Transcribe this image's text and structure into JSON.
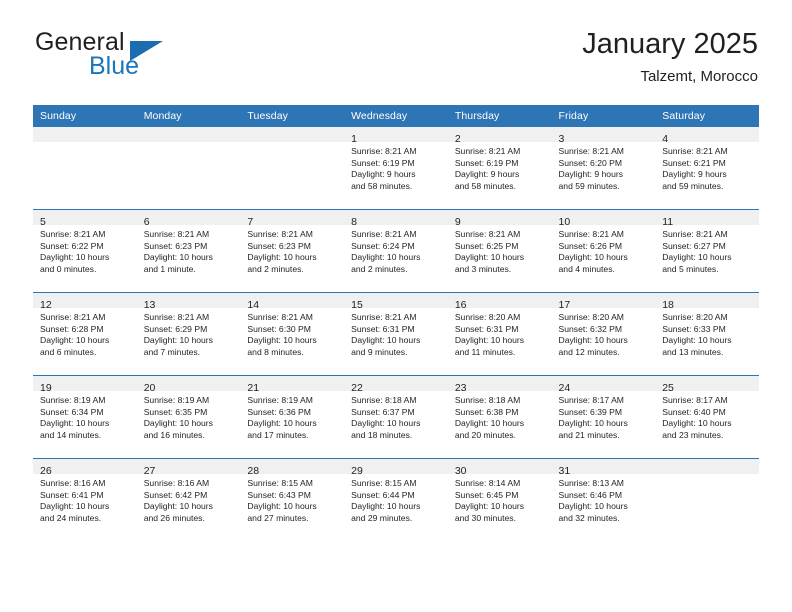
{
  "brand": {
    "name_part1": "General",
    "name_part2": "Blue",
    "logo_icon": "triangle-logo-icon"
  },
  "header": {
    "title": "January 2025",
    "subtitle": "Talzemt, Morocco"
  },
  "colors": {
    "header_blue": "#2e75b6",
    "brand_blue": "#1b75bb",
    "daynum_bg": "#f0f0f0",
    "text": "#231f20"
  },
  "weekday_headers": [
    "Sunday",
    "Monday",
    "Tuesday",
    "Wednesday",
    "Thursday",
    "Friday",
    "Saturday"
  ],
  "weeks": [
    [
      {
        "day": "",
        "sunrise": "",
        "sunset": "",
        "daylight1": "",
        "daylight2": ""
      },
      {
        "day": "",
        "sunrise": "",
        "sunset": "",
        "daylight1": "",
        "daylight2": ""
      },
      {
        "day": "",
        "sunrise": "",
        "sunset": "",
        "daylight1": "",
        "daylight2": ""
      },
      {
        "day": "1",
        "sunrise": "Sunrise: 8:21 AM",
        "sunset": "Sunset: 6:19 PM",
        "daylight1": "Daylight: 9 hours",
        "daylight2": "and 58 minutes."
      },
      {
        "day": "2",
        "sunrise": "Sunrise: 8:21 AM",
        "sunset": "Sunset: 6:19 PM",
        "daylight1": "Daylight: 9 hours",
        "daylight2": "and 58 minutes."
      },
      {
        "day": "3",
        "sunrise": "Sunrise: 8:21 AM",
        "sunset": "Sunset: 6:20 PM",
        "daylight1": "Daylight: 9 hours",
        "daylight2": "and 59 minutes."
      },
      {
        "day": "4",
        "sunrise": "Sunrise: 8:21 AM",
        "sunset": "Sunset: 6:21 PM",
        "daylight1": "Daylight: 9 hours",
        "daylight2": "and 59 minutes."
      }
    ],
    [
      {
        "day": "5",
        "sunrise": "Sunrise: 8:21 AM",
        "sunset": "Sunset: 6:22 PM",
        "daylight1": "Daylight: 10 hours",
        "daylight2": "and 0 minutes."
      },
      {
        "day": "6",
        "sunrise": "Sunrise: 8:21 AM",
        "sunset": "Sunset: 6:23 PM",
        "daylight1": "Daylight: 10 hours",
        "daylight2": "and 1 minute."
      },
      {
        "day": "7",
        "sunrise": "Sunrise: 8:21 AM",
        "sunset": "Sunset: 6:23 PM",
        "daylight1": "Daylight: 10 hours",
        "daylight2": "and 2 minutes."
      },
      {
        "day": "8",
        "sunrise": "Sunrise: 8:21 AM",
        "sunset": "Sunset: 6:24 PM",
        "daylight1": "Daylight: 10 hours",
        "daylight2": "and 2 minutes."
      },
      {
        "day": "9",
        "sunrise": "Sunrise: 8:21 AM",
        "sunset": "Sunset: 6:25 PM",
        "daylight1": "Daylight: 10 hours",
        "daylight2": "and 3 minutes."
      },
      {
        "day": "10",
        "sunrise": "Sunrise: 8:21 AM",
        "sunset": "Sunset: 6:26 PM",
        "daylight1": "Daylight: 10 hours",
        "daylight2": "and 4 minutes."
      },
      {
        "day": "11",
        "sunrise": "Sunrise: 8:21 AM",
        "sunset": "Sunset: 6:27 PM",
        "daylight1": "Daylight: 10 hours",
        "daylight2": "and 5 minutes."
      }
    ],
    [
      {
        "day": "12",
        "sunrise": "Sunrise: 8:21 AM",
        "sunset": "Sunset: 6:28 PM",
        "daylight1": "Daylight: 10 hours",
        "daylight2": "and 6 minutes."
      },
      {
        "day": "13",
        "sunrise": "Sunrise: 8:21 AM",
        "sunset": "Sunset: 6:29 PM",
        "daylight1": "Daylight: 10 hours",
        "daylight2": "and 7 minutes."
      },
      {
        "day": "14",
        "sunrise": "Sunrise: 8:21 AM",
        "sunset": "Sunset: 6:30 PM",
        "daylight1": "Daylight: 10 hours",
        "daylight2": "and 8 minutes."
      },
      {
        "day": "15",
        "sunrise": "Sunrise: 8:21 AM",
        "sunset": "Sunset: 6:31 PM",
        "daylight1": "Daylight: 10 hours",
        "daylight2": "and 9 minutes."
      },
      {
        "day": "16",
        "sunrise": "Sunrise: 8:20 AM",
        "sunset": "Sunset: 6:31 PM",
        "daylight1": "Daylight: 10 hours",
        "daylight2": "and 11 minutes."
      },
      {
        "day": "17",
        "sunrise": "Sunrise: 8:20 AM",
        "sunset": "Sunset: 6:32 PM",
        "daylight1": "Daylight: 10 hours",
        "daylight2": "and 12 minutes."
      },
      {
        "day": "18",
        "sunrise": "Sunrise: 8:20 AM",
        "sunset": "Sunset: 6:33 PM",
        "daylight1": "Daylight: 10 hours",
        "daylight2": "and 13 minutes."
      }
    ],
    [
      {
        "day": "19",
        "sunrise": "Sunrise: 8:19 AM",
        "sunset": "Sunset: 6:34 PM",
        "daylight1": "Daylight: 10 hours",
        "daylight2": "and 14 minutes."
      },
      {
        "day": "20",
        "sunrise": "Sunrise: 8:19 AM",
        "sunset": "Sunset: 6:35 PM",
        "daylight1": "Daylight: 10 hours",
        "daylight2": "and 16 minutes."
      },
      {
        "day": "21",
        "sunrise": "Sunrise: 8:19 AM",
        "sunset": "Sunset: 6:36 PM",
        "daylight1": "Daylight: 10 hours",
        "daylight2": "and 17 minutes."
      },
      {
        "day": "22",
        "sunrise": "Sunrise: 8:18 AM",
        "sunset": "Sunset: 6:37 PM",
        "daylight1": "Daylight: 10 hours",
        "daylight2": "and 18 minutes."
      },
      {
        "day": "23",
        "sunrise": "Sunrise: 8:18 AM",
        "sunset": "Sunset: 6:38 PM",
        "daylight1": "Daylight: 10 hours",
        "daylight2": "and 20 minutes."
      },
      {
        "day": "24",
        "sunrise": "Sunrise: 8:17 AM",
        "sunset": "Sunset: 6:39 PM",
        "daylight1": "Daylight: 10 hours",
        "daylight2": "and 21 minutes."
      },
      {
        "day": "25",
        "sunrise": "Sunrise: 8:17 AM",
        "sunset": "Sunset: 6:40 PM",
        "daylight1": "Daylight: 10 hours",
        "daylight2": "and 23 minutes."
      }
    ],
    [
      {
        "day": "26",
        "sunrise": "Sunrise: 8:16 AM",
        "sunset": "Sunset: 6:41 PM",
        "daylight1": "Daylight: 10 hours",
        "daylight2": "and 24 minutes."
      },
      {
        "day": "27",
        "sunrise": "Sunrise: 8:16 AM",
        "sunset": "Sunset: 6:42 PM",
        "daylight1": "Daylight: 10 hours",
        "daylight2": "and 26 minutes."
      },
      {
        "day": "28",
        "sunrise": "Sunrise: 8:15 AM",
        "sunset": "Sunset: 6:43 PM",
        "daylight1": "Daylight: 10 hours",
        "daylight2": "and 27 minutes."
      },
      {
        "day": "29",
        "sunrise": "Sunrise: 8:15 AM",
        "sunset": "Sunset: 6:44 PM",
        "daylight1": "Daylight: 10 hours",
        "daylight2": "and 29 minutes."
      },
      {
        "day": "30",
        "sunrise": "Sunrise: 8:14 AM",
        "sunset": "Sunset: 6:45 PM",
        "daylight1": "Daylight: 10 hours",
        "daylight2": "and 30 minutes."
      },
      {
        "day": "31",
        "sunrise": "Sunrise: 8:13 AM",
        "sunset": "Sunset: 6:46 PM",
        "daylight1": "Daylight: 10 hours",
        "daylight2": "and 32 minutes."
      },
      {
        "day": "",
        "sunrise": "",
        "sunset": "",
        "daylight1": "",
        "daylight2": ""
      }
    ]
  ]
}
